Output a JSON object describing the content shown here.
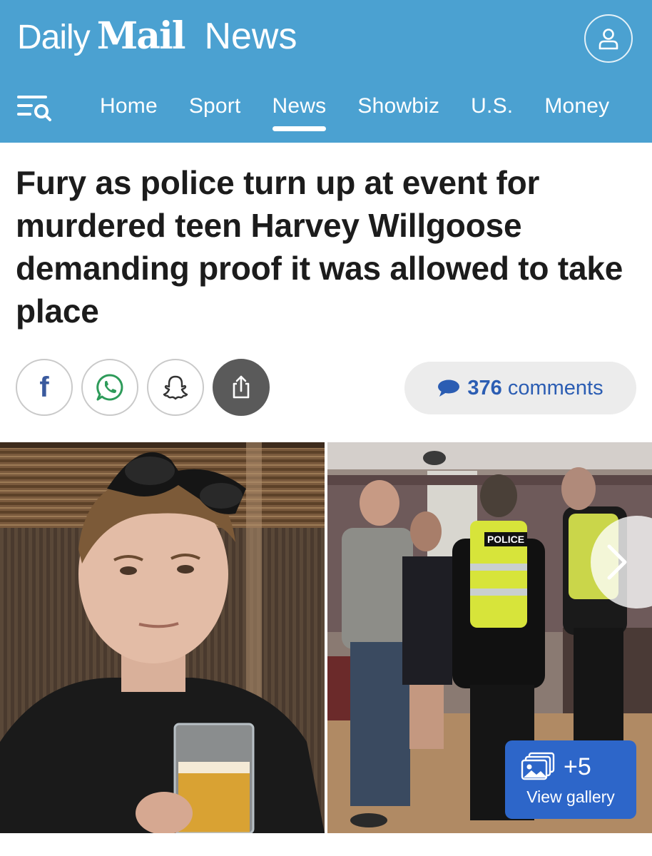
{
  "header": {
    "brand_daily": "Daily",
    "brand_mail": "Mail",
    "section_title": "News",
    "background_color": "#4ba1d1",
    "account_icon": "user-icon",
    "menu_icon": "menu-search-icon"
  },
  "nav": {
    "items": [
      {
        "label": "Home"
      },
      {
        "label": "Sport"
      },
      {
        "label": "News",
        "active": true
      },
      {
        "label": "Showbiz"
      },
      {
        "label": "U.S."
      },
      {
        "label": "Money"
      }
    ]
  },
  "article": {
    "headline": "Fury as police turn up at event for murdered teen Harvey Willgoose demanding proof it was allowed to take place"
  },
  "share": {
    "buttons": [
      {
        "icon": "facebook-icon"
      },
      {
        "icon": "whatsapp-icon"
      },
      {
        "icon": "snapchat-icon"
      },
      {
        "icon": "share-icon"
      }
    ]
  },
  "comments": {
    "count": "376",
    "label": "comments",
    "color": "#2b5db3"
  },
  "gallery": {
    "count": "+5",
    "label": "View gallery",
    "button_color": "#2d66c9",
    "police_vest_text": "POLICE"
  }
}
